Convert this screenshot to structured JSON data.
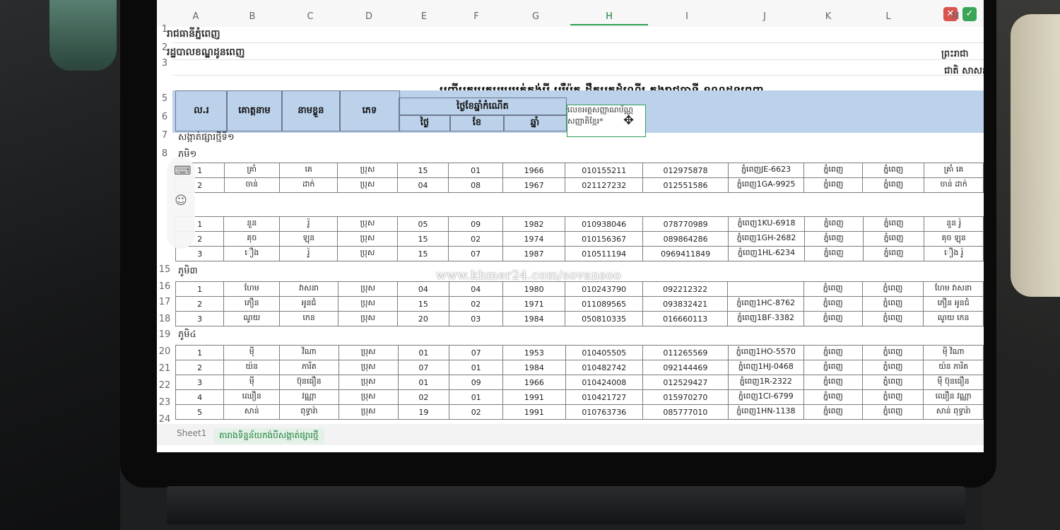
{
  "colors": {
    "accent": "#2e9e57",
    "header_band": "#bcd1ea",
    "close": "#d9534f",
    "ok": "#3aa556"
  },
  "window": {
    "close_icon": "close-icon",
    "ok_icon": "check-icon"
  },
  "columns": [
    "A",
    "B",
    "C",
    "D",
    "E",
    "F",
    "G",
    "H",
    "I",
    "J",
    "K",
    "L",
    "M"
  ],
  "active_column": "H",
  "rows": [
    "1",
    "2",
    "3",
    "5",
    "6",
    "7",
    "8",
    "15",
    "16",
    "17",
    "18",
    "19",
    "20",
    "21",
    "22",
    "23",
    "24"
  ],
  "top_left": {
    "r1": "រាជធានីភ្នំពេញ",
    "r2": "រដ្ឋបាលខណ្ឌដូនពេញ"
  },
  "top_right": {
    "r2": "ព្រះរាជា",
    "r3": "ជាតិ សាសន"
  },
  "title": "បញ្ជីអ្នកប្រកបរបររត់កង់បី ឬរ៉ឺម៉ក ដឹកអ្នកដំណើរ ក្នុងរាជធានី ខណ្ឌដូនពេញ",
  "headers": {
    "no": "ល.រ",
    "surname": "គោត្តនាម",
    "name": "នាមខ្លួន",
    "sex": "ភេទ",
    "dob": "ថ្ងៃខែឆ្នាំកំណើត",
    "day": "ថ្ងៃ",
    "month": "ខែ",
    "year": "ឆ្នាំ",
    "id_note": "លេខអត្តសញ្ញាណប័ណ្ណ សញ្ញាតិខ្មែរ*"
  },
  "group_labels": {
    "g7": "សង្កាត់ផ្សារថ្មីទី១",
    "g8": "ភូមិ១",
    "g15": "ភូមិ៣",
    "g19": "ភូមិ៤"
  },
  "group1": [
    [
      "1",
      "គ្រាំ",
      "គេ",
      "ប្រុស",
      "15",
      "01",
      "1966",
      "010155211",
      "012975878",
      "ភ្នំពេញJE-6623",
      "ភ្នំពេញ",
      "ភ្នំពេញ",
      "គ្រាំ គេ"
    ],
    [
      "2",
      "ចាន់",
      "ដាក់",
      "ប្រុស",
      "04",
      "08",
      "1967",
      "021127232",
      "012551586",
      "ភ្នំពេញ1GA-9925",
      "ភ្នំពេញ",
      "ភ្នំពេញ",
      "ចាន់ ដាក់"
    ]
  ],
  "group2": [
    [
      "1",
      "នួន",
      "រ៉ូ",
      "ប្រុស",
      "05",
      "09",
      "1982",
      "010938046",
      "078770989",
      "ភ្នំពេញ1KU-6918",
      "ភ្នំពេញ",
      "ភ្នំពេញ",
      "នួន រ៉ូ"
    ],
    [
      "2",
      "គុច",
      "ឡុន",
      "ប្រុស",
      "15",
      "02",
      "1974",
      "010156367",
      "089864286",
      "ភ្នំពេញ1GH-2682",
      "ភ្នំពេញ",
      "ភ្នំពេញ",
      "គុច ឡុន"
    ],
    [
      "3",
      "ឿង",
      "រ៉ូ",
      "ប្រុស",
      "15",
      "07",
      "1987",
      "010511194",
      "0969411849",
      "ភ្នំពេញ1HL-6234",
      "ភ្នំពេញ",
      "ភ្នំពេញ",
      "ឿង រ៉ូ"
    ]
  ],
  "group3": [
    [
      "1",
      "ហែម",
      "វាសនា",
      "ប្រុស",
      "04",
      "04",
      "1980",
      "010243790",
      "092212322",
      "",
      "ភ្នំពេញ",
      "ភ្នំពេញ",
      "ហែម វាសនា"
    ],
    [
      "2",
      "ភឿន",
      "អូនជំ",
      "ប្រុស",
      "15",
      "02",
      "1971",
      "011089565",
      "093832421",
      "ភ្នំពេញ1HC-8762",
      "ភ្នំពេញ",
      "ភ្នំពេញ",
      "ភឿន អូនជំ"
    ],
    [
      "3",
      "ណូយ",
      "កេន",
      "ប្រុស",
      "20",
      "03",
      "1984",
      "050810335",
      "016660113",
      "ភ្នំពេញ1BF-3382",
      "ភ្នំពេញ",
      "ភ្នំពេញ",
      "ណូយ កេន"
    ]
  ],
  "group4": [
    [
      "1",
      "ម៉ី",
      "វិណា",
      "ប្រុស",
      "01",
      "07",
      "1953",
      "010405505",
      "011265569",
      "ភ្នំពេញ1HO-5570",
      "ភ្នំពេញ",
      "ភ្នំពេញ",
      "ម៉ី វិណា"
    ],
    [
      "2",
      "យ៉ន",
      "ភារិត",
      "ប្រុស",
      "07",
      "01",
      "1984",
      "010482742",
      "092144469",
      "ភ្នំពេញ1HJ-0468",
      "ភ្នំពេញ",
      "ភ្នំពេញ",
      "យ៉ន ភារិត"
    ],
    [
      "3",
      "ម៉ី",
      "ប៊ុនធឿន",
      "ប្រុស",
      "01",
      "09",
      "1966",
      "010424008",
      "012529427",
      "ភ្នំពេញ1R-2322",
      "ភ្នំពេញ",
      "ភ្នំពេញ",
      "ម៉ី ប៊ុនធឿន"
    ],
    [
      "4",
      "ឈឿន",
      "វណ្ណា",
      "ប្រុស",
      "02",
      "01",
      "1991",
      "010421727",
      "015970270",
      "ភ្នំពេញ1CI-6799",
      "ភ្នំពេញ",
      "ភ្នំពេញ",
      "ឈឿន វណ្ណា"
    ],
    [
      "5",
      "សាន់",
      "ពុទ្ធារ៉ា",
      "ប្រុស",
      "19",
      "02",
      "1991",
      "010763736",
      "085777010",
      "ភ្នំពេញ1HN-1138",
      "ភ្នំពេញ",
      "ភ្នំពេញ",
      "សាន់ ពុទ្ធារ៉ា"
    ]
  ],
  "watermark": "www.khmer24.com/sovansoo",
  "sheets": [
    "Sheet1",
    "តារាងទិន្នន័យកង់បីសង្កាត់ផ្សារថ្មី"
  ],
  "tools": {
    "keyboard": "keyboard-icon",
    "emoji": "emoji-icon"
  }
}
